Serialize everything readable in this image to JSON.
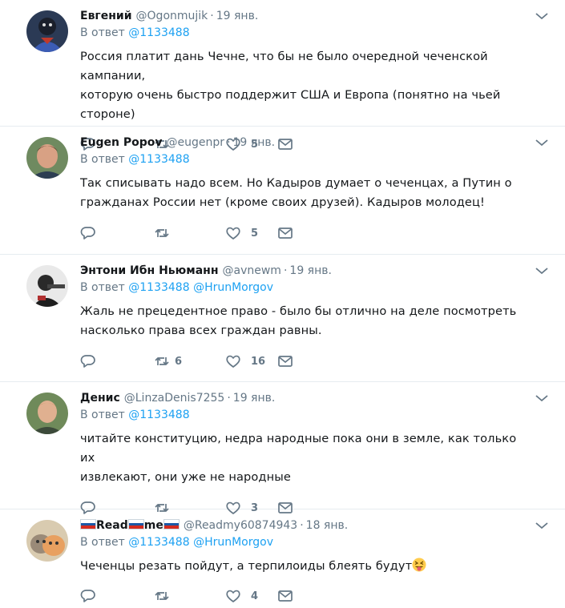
{
  "tweets": [
    {
      "name": "Евгений",
      "handle": "@Ogonmujik",
      "dot": "·",
      "time": "19 янв.",
      "reply_prefix": "В ответ",
      "reply_mentions": [
        "@1133488"
      ],
      "lines": [
        "Россия платит дань Чечне, что бы не было очередной чеченской кампании,",
        "которую очень быстро поддержит США и Европа (понятно на чьей стороне)"
      ],
      "retweets": "",
      "likes": "5",
      "avatar_color": "#2b3a55"
    },
    {
      "name": "Eugen Popov",
      "handle": "@eugenpr",
      "dot": "·",
      "time": "19 янв.",
      "reply_prefix": "В ответ",
      "reply_mentions": [
        "@1133488"
      ],
      "lines": [
        "Так списывать надо всем. Но Кадыров думает о чеченцах, а Путин о",
        "гражданах России нет (кроме своих друзей). Кадыров молодец!"
      ],
      "retweets": "",
      "likes": "5",
      "avatar_color": "#7a8c6a"
    },
    {
      "name": "Энтони Ибн Ньюманн",
      "handle": "@avnewm",
      "dot": "·",
      "time": "19 янв.",
      "reply_prefix": "В ответ",
      "reply_mentions": [
        "@1133488",
        "@HrunMorgov"
      ],
      "lines": [
        "Жаль не прецедентное право - было бы отлично на деле посмотреть",
        "насколько права всех граждан равны."
      ],
      "retweets": "6",
      "likes": "16",
      "avatar_color": "#3a3a3a"
    },
    {
      "name": "Денис",
      "handle": "@LinzaDenis7255",
      "dot": "·",
      "time": "19 янв.",
      "reply_prefix": "В ответ",
      "reply_mentions": [
        "@1133488"
      ],
      "lines": [
        "читайте конституцию, недра народные пока они в земле, как только их",
        "извлекают, они уже не народные"
      ],
      "retweets": "",
      "likes": "3",
      "avatar_color": "#6f8a5a"
    },
    {
      "name_parts": [
        "Read",
        "me"
      ],
      "handle": "@Readmy60874943",
      "dot": "·",
      "time": "18 янв.",
      "reply_prefix": "В ответ",
      "reply_mentions": [
        "@1133488",
        "@HrunMorgov"
      ],
      "lines": [
        "Чеченцы резать пойдут, а терпилоиды блеять будут"
      ],
      "retweets": "",
      "likes": "4",
      "avatar_color": "#c9b89a"
    }
  ],
  "colors": {
    "accent": "#1da1f2",
    "muted": "#657786",
    "text": "#14171a",
    "border": "#e6ecf0"
  },
  "icons": [
    "reply-icon",
    "retweet-icon",
    "like-icon",
    "message-icon",
    "chevron-down-icon",
    "russia-flag-icon",
    "tongue-emoji-icon"
  ]
}
